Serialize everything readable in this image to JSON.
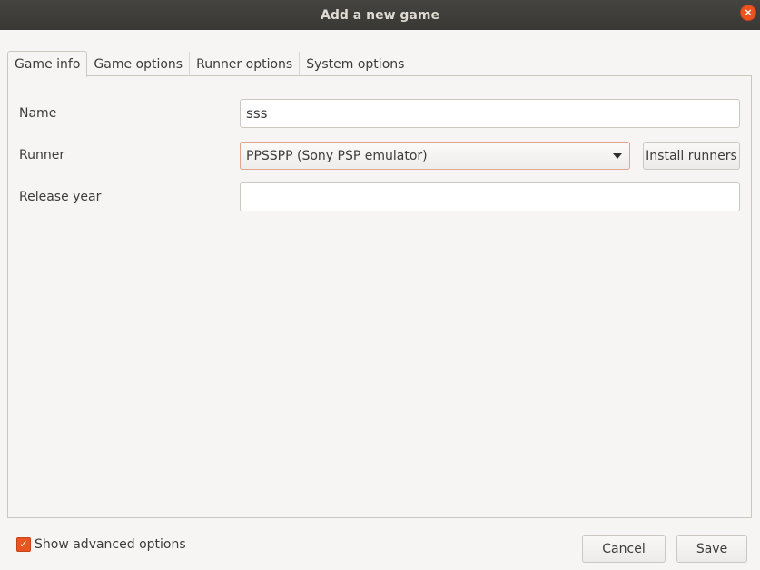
{
  "window": {
    "title": "Add a new game",
    "close_glyph": "×"
  },
  "tabs": [
    {
      "label": "Game info",
      "active": true
    },
    {
      "label": "Game options",
      "active": false
    },
    {
      "label": "Runner options",
      "active": false
    },
    {
      "label": "System options",
      "active": false
    }
  ],
  "form": {
    "name_label": "Name",
    "name_value": "sss",
    "runner_label": "Runner",
    "runner_selected": "PPSSPP (Sony PSP emulator)",
    "install_runners_label": "Install runners",
    "release_year_label": "Release year",
    "release_year_value": ""
  },
  "footer": {
    "show_advanced_label": "Show advanced options",
    "show_advanced_checked": true,
    "check_glyph": "✓",
    "cancel_label": "Cancel",
    "save_label": "Save"
  },
  "colors": {
    "accent": "#e95420",
    "titlebar": "#3d3c39"
  }
}
